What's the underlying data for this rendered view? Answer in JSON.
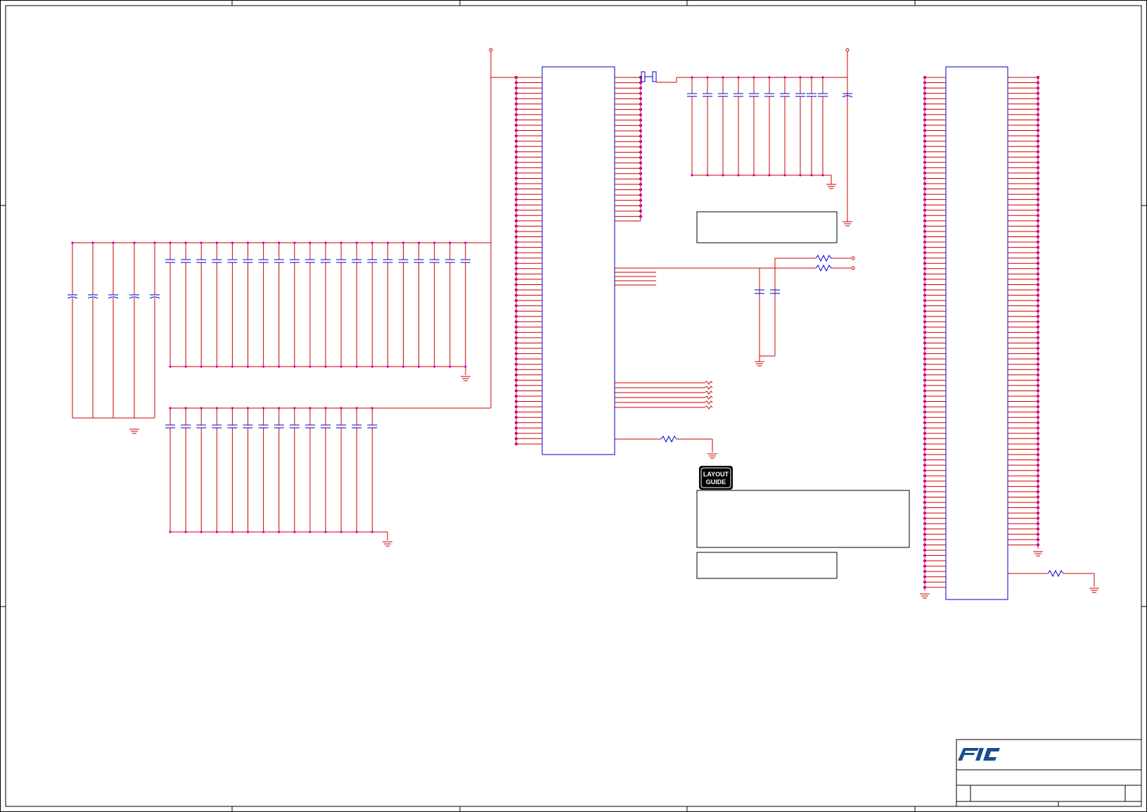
{
  "layout_guide": {
    "line1": "LAYOUT",
    "line2": "GUIDE"
  },
  "colors": {
    "wire": "#cc0000",
    "component": "#0000cc",
    "junction": "#cc00cc",
    "frame": "#000000",
    "logo": "#1a4e8c"
  },
  "icons": [
    "company-logo",
    "layout-guide-badge"
  ]
}
